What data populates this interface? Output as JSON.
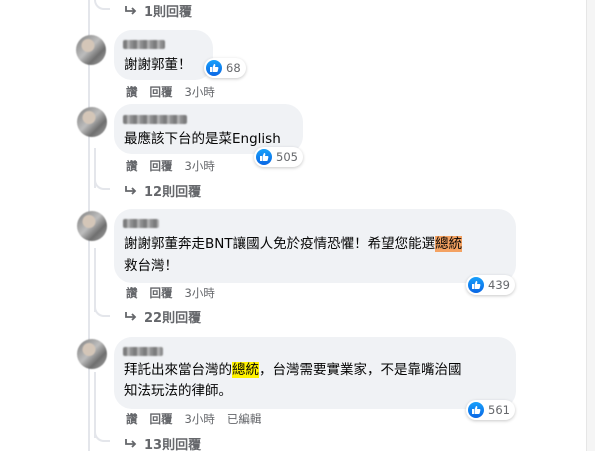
{
  "comments": [
    {
      "name": "",
      "text_lines": [
        "謝謝郭董！"
      ],
      "like_count": "68",
      "actions": [
        "讚",
        "回覆"
      ],
      "time": "3小時",
      "edited": "",
      "replies_label": ""
    },
    {
      "name": "",
      "text_lines": [
        "最應該下台的是菜English"
      ],
      "like_count": "505",
      "actions": [
        "讚",
        "回覆"
      ],
      "time": "3小時",
      "edited": "",
      "replies_label": "12則回覆"
    },
    {
      "name": "",
      "text_lines": [
        "謝謝郭董奔走BNT讓國人免於疫情恐懼！希望您能選",
        "總統",
        "救台灣！"
      ],
      "like_count": "439",
      "actions": [
        "讚",
        "回覆"
      ],
      "time": "3小時",
      "edited": "",
      "replies_label": "22則回覆"
    },
    {
      "name": "",
      "text_lines": [
        "拜託出來當台灣的",
        "總統",
        "，台灣需要實業家，不是靠嘴治國",
        "知法玩法的律師。"
      ],
      "like_count": "561",
      "actions": [
        "讚",
        "回覆"
      ],
      "time": "3小時",
      "edited": "已編輯",
      "replies_label": "13則回覆"
    }
  ],
  "top_replies_label": "1則回覆",
  "colors": {
    "bubble": "#f0f2f5",
    "secondary_text": "#65676b",
    "like_blue": "#0a66e4",
    "highlight_orange": "#f4a262",
    "highlight_yellow": "#fff200"
  },
  "icons": {
    "reply": "reply-arrow-icon",
    "like": "thumbs-up-icon"
  }
}
